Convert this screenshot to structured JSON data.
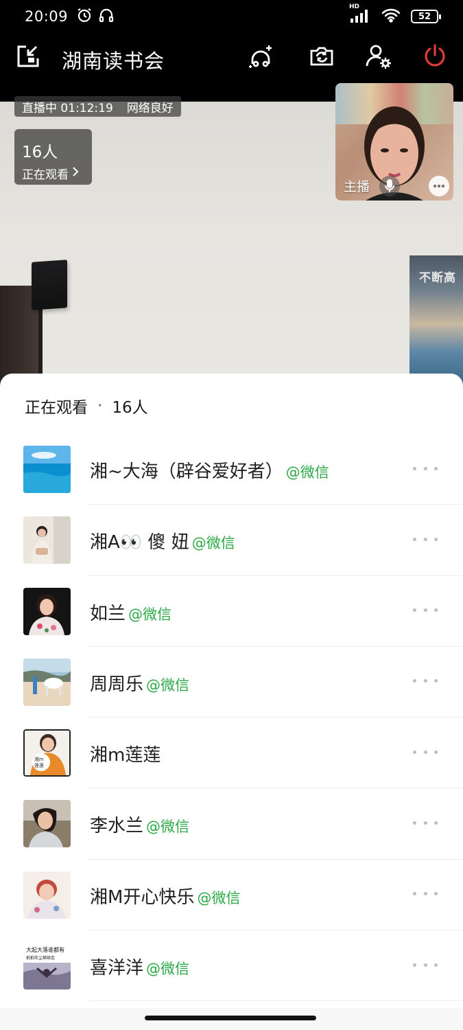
{
  "status_bar": {
    "time": "20:09",
    "alarm_icon": "alarm-clock-icon",
    "headset_icon": "headset-icon",
    "network_badge": "HD",
    "battery_level": "52"
  },
  "app_bar": {
    "title": "湖南读书会",
    "minimize_icon": "picture-in-picture-icon",
    "beauty_icon": "beauty-filter-icon",
    "flip_icon": "flip-camera-icon",
    "settings_icon": "user-settings-icon",
    "power_icon": "power-icon",
    "power_color": "#e03a3a"
  },
  "live": {
    "status_text": "直播中 01:12:19",
    "network_text": "网络良好",
    "viewer_count": "16人",
    "viewer_label": "正在观看"
  },
  "host_pip": {
    "label": "主播"
  },
  "sheet": {
    "title": "正在观看",
    "separator": "·",
    "count": "16人",
    "viewers": [
      {
        "name": "湘~大海（辟谷爱好者）",
        "tag": "@微信"
      },
      {
        "name": "湘A👀 傻 妞",
        "tag": "@微信"
      },
      {
        "name": "如兰",
        "tag": "@微信"
      },
      {
        "name": "周周乐",
        "tag": "@微信"
      },
      {
        "name": "湘m莲莲",
        "tag": ""
      },
      {
        "name": "李水兰",
        "tag": "@微信"
      },
      {
        "name": "湘M开心快乐",
        "tag": "@微信"
      },
      {
        "name": "喜洋洋",
        "tag": "@微信"
      }
    ],
    "avatar_5_text_1": "湘m",
    "avatar_5_text_2": "莲莲",
    "avatar_8_text_1": "大起大落谁都有",
    "avatar_8_text_2": "拍拍灰尘继续走"
  },
  "poster_text": "不断高",
  "colors": {
    "wechat_green": "#2aa845",
    "sheet_bg": "#ffffff",
    "top_bar_bg": "#000000"
  }
}
